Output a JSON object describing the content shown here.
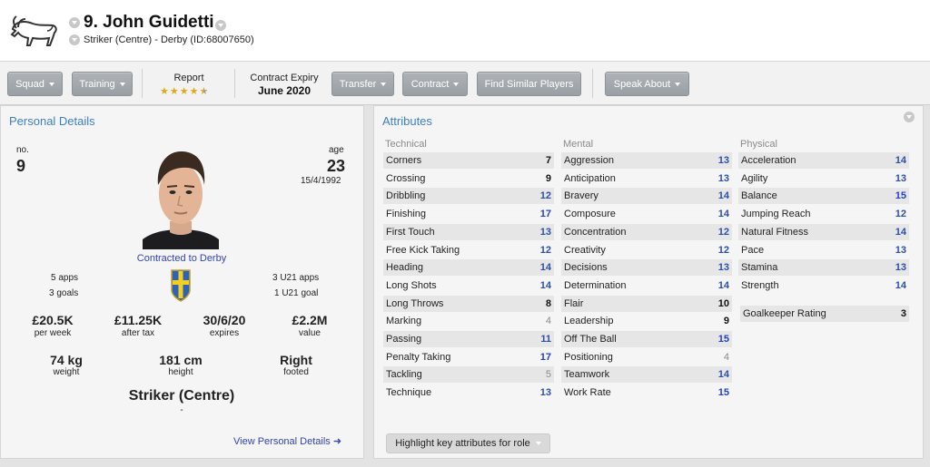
{
  "header": {
    "player_name": "9. John Guidetti",
    "subtitle": "Striker (Centre) - Derby (ID:68007650)"
  },
  "toolbar": {
    "squad": "Squad",
    "training": "Training",
    "report_label": "Report",
    "report_stars": 4.5,
    "contract_expiry_label": "Contract Expiry",
    "contract_expiry_value": "June 2020",
    "transfer": "Transfer",
    "contract": "Contract",
    "find_similar": "Find Similar Players",
    "speak_about": "Speak About"
  },
  "personal": {
    "title": "Personal Details",
    "no_label": "no.",
    "no_value": "9",
    "age_label": "age",
    "age_value": "23",
    "dob": "15/4/1992",
    "contracted": "Contracted to Derby",
    "apps": "5 apps",
    "goals": "3 goals",
    "u21_apps": "3 U21 apps",
    "u21_goals": "1 U21 goal",
    "wage_value": "£20.5K",
    "wage_label": "per week",
    "after_tax_value": "£11.25K",
    "after_tax_label": "after tax",
    "expires_value": "30/6/20",
    "expires_label": "expires",
    "value_value": "£2.2M",
    "value_label": "value",
    "weight_value": "74 kg",
    "weight_label": "weight",
    "height_value": "181 cm",
    "height_label": "height",
    "foot_value": "Right",
    "foot_label": "footed",
    "position": "Striker (Centre)",
    "position_sub": "-",
    "view_link": "View Personal Details ➜"
  },
  "attributes": {
    "title": "Attributes",
    "technical_label": "Technical",
    "mental_label": "Mental",
    "physical_label": "Physical",
    "technical": [
      {
        "name": "Corners",
        "value": 7
      },
      {
        "name": "Crossing",
        "value": 9
      },
      {
        "name": "Dribbling",
        "value": 12
      },
      {
        "name": "Finishing",
        "value": 17
      },
      {
        "name": "First Touch",
        "value": 13
      },
      {
        "name": "Free Kick Taking",
        "value": 12
      },
      {
        "name": "Heading",
        "value": 14
      },
      {
        "name": "Long Shots",
        "value": 14
      },
      {
        "name": "Long Throws",
        "value": 8
      },
      {
        "name": "Marking",
        "value": 4
      },
      {
        "name": "Passing",
        "value": 11
      },
      {
        "name": "Penalty Taking",
        "value": 17
      },
      {
        "name": "Tackling",
        "value": 5
      },
      {
        "name": "Technique",
        "value": 13
      }
    ],
    "mental": [
      {
        "name": "Aggression",
        "value": 13
      },
      {
        "name": "Anticipation",
        "value": 13
      },
      {
        "name": "Bravery",
        "value": 14
      },
      {
        "name": "Composure",
        "value": 14
      },
      {
        "name": "Concentration",
        "value": 12
      },
      {
        "name": "Creativity",
        "value": 12
      },
      {
        "name": "Decisions",
        "value": 13
      },
      {
        "name": "Determination",
        "value": 14
      },
      {
        "name": "Flair",
        "value": 10
      },
      {
        "name": "Leadership",
        "value": 9
      },
      {
        "name": "Off The Ball",
        "value": 15
      },
      {
        "name": "Positioning",
        "value": 4
      },
      {
        "name": "Teamwork",
        "value": 14
      },
      {
        "name": "Work Rate",
        "value": 15
      }
    ],
    "physical": [
      {
        "name": "Acceleration",
        "value": 14
      },
      {
        "name": "Agility",
        "value": 13
      },
      {
        "name": "Balance",
        "value": 15
      },
      {
        "name": "Jumping Reach",
        "value": 12
      },
      {
        "name": "Natural Fitness",
        "value": 14
      },
      {
        "name": "Pace",
        "value": 13
      },
      {
        "name": "Stamina",
        "value": 13
      },
      {
        "name": "Strength",
        "value": 14
      }
    ],
    "gk_rating_label": "Goalkeeper Rating",
    "gk_rating_value": 3,
    "highlight_button": "Highlight key attributes for role"
  }
}
